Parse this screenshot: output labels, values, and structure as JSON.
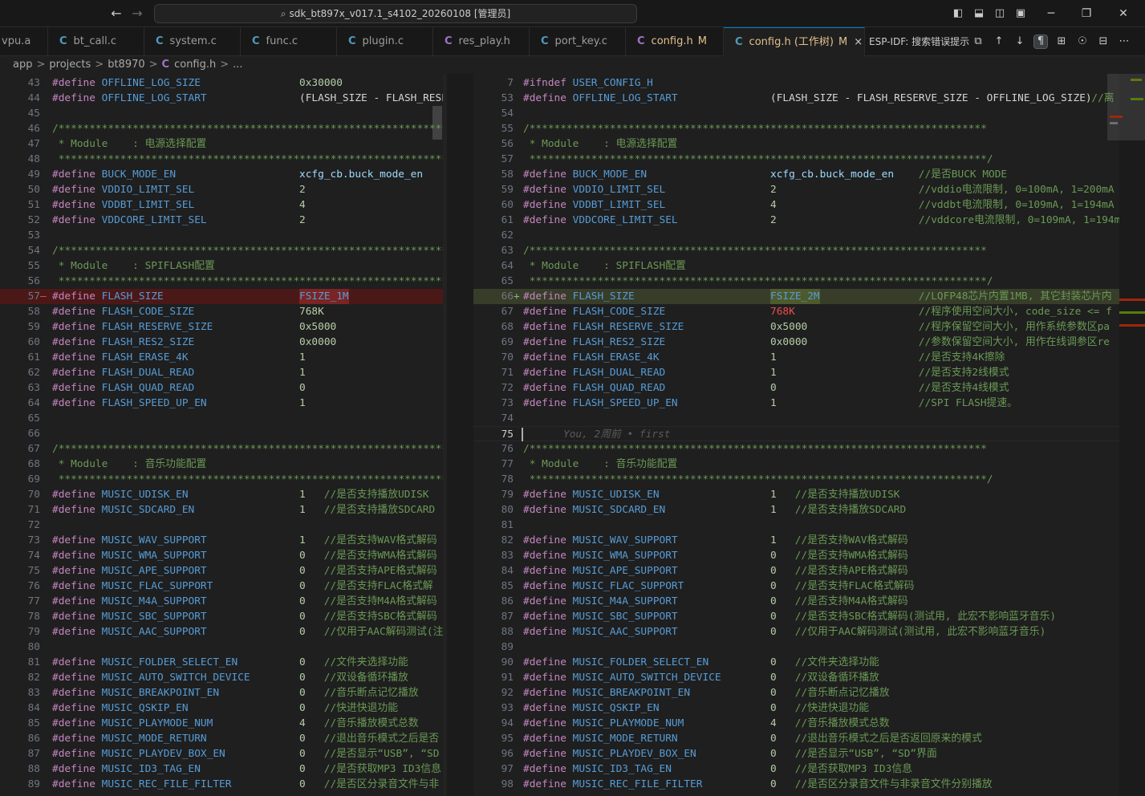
{
  "titlebar": {
    "search_text": "sdk_bt897x_v017.1_s4102_20260108 [管理员]",
    "back_icon": "arrow-left-icon",
    "forward_icon": "arrow-right-icon"
  },
  "tabs": [
    {
      "label": "vpu.a",
      "icon": "",
      "modified": false
    },
    {
      "label": "bt_call.c",
      "icon": "C",
      "modified": false
    },
    {
      "label": "system.c",
      "icon": "C",
      "modified": false
    },
    {
      "label": "func.c",
      "icon": "C",
      "modified": false
    },
    {
      "label": "plugin.c",
      "icon": "C",
      "modified": false
    },
    {
      "label": "res_play.h",
      "icon": "C",
      "modified": false
    },
    {
      "label": "port_key.c",
      "icon": "C",
      "modified": false
    },
    {
      "label": "config.h",
      "icon": "C",
      "modified": true,
      "mark": "M"
    },
    {
      "label": "config.h (工作树)",
      "icon": "C",
      "modified": true,
      "mark": "M",
      "active": true,
      "close": "×"
    }
  ],
  "toolbar": {
    "esp_label": "ESP-IDF: 搜索错误提示"
  },
  "breadcrumb": {
    "items": [
      "app",
      "projects",
      "bt8970",
      "config.h",
      "..."
    ],
    "file_icon": "C",
    "sep": ">"
  },
  "left_editor": {
    "lines": [
      {
        "n": "43",
        "t": "define",
        "name": "OFFLINE_LOG_SIZE",
        "value": "0x30000"
      },
      {
        "n": "44",
        "t": "define",
        "name": "OFFLINE_LOG_START",
        "value": "(FLASH_SIZE - FLASH_RESE"
      },
      {
        "n": "45",
        "t": "blank"
      },
      {
        "n": "46",
        "t": "star",
        "text": "/**************************************************************************************"
      },
      {
        "n": "47",
        "t": "module",
        "text": " * Module    : 电源选择配置"
      },
      {
        "n": "48",
        "t": "star",
        "text": " **************************************************************************************"
      },
      {
        "n": "49",
        "t": "define",
        "name": "BUCK_MODE_EN",
        "value": "xcfg_cb.buck_mode_en"
      },
      {
        "n": "50",
        "t": "define",
        "name": "VDDIO_LIMIT_SEL",
        "value": "2"
      },
      {
        "n": "51",
        "t": "define",
        "name": "VDDBT_LIMIT_SEL",
        "value": "4"
      },
      {
        "n": "52",
        "t": "define",
        "name": "VDDCORE_LIMIT_SEL",
        "value": "2"
      },
      {
        "n": "53",
        "t": "blank"
      },
      {
        "n": "54",
        "t": "star",
        "text": "/**************************************************************************************"
      },
      {
        "n": "55",
        "t": "module",
        "text": " * Module    : SPIFLASH配置"
      },
      {
        "n": "56",
        "t": "star",
        "text": " **************************************************************************************"
      },
      {
        "n": "57",
        "t": "define",
        "name": "FLASH_SIZE",
        "value": "FSIZE_1M",
        "diff": "del",
        "marker": "—"
      },
      {
        "n": "58",
        "t": "define",
        "name": "FLASH_CODE_SIZE",
        "value": "768K"
      },
      {
        "n": "59",
        "t": "define",
        "name": "FLASH_RESERVE_SIZE",
        "value": "0x5000"
      },
      {
        "n": "60",
        "t": "define",
        "name": "FLASH_RES2_SIZE",
        "value": "0x0000"
      },
      {
        "n": "61",
        "t": "define",
        "name": "FLASH_ERASE_4K",
        "value": "1"
      },
      {
        "n": "62",
        "t": "define",
        "name": "FLASH_DUAL_READ",
        "value": "1"
      },
      {
        "n": "63",
        "t": "define",
        "name": "FLASH_QUAD_READ",
        "value": "0"
      },
      {
        "n": "64",
        "t": "define",
        "name": "FLASH_SPEED_UP_EN",
        "value": "1"
      },
      {
        "n": "65",
        "t": "blank"
      },
      {
        "n": "66",
        "t": "blank"
      },
      {
        "n": "67",
        "t": "star",
        "text": "/**************************************************************************************"
      },
      {
        "n": "68",
        "t": "module",
        "text": " * Module    : 音乐功能配置"
      },
      {
        "n": "69",
        "t": "star",
        "text": " **************************************************************************************"
      },
      {
        "n": "70",
        "t": "define",
        "name": "MUSIC_UDISK_EN",
        "value": "1",
        "comment": "//是否支持播放UDISK"
      },
      {
        "n": "71",
        "t": "define",
        "name": "MUSIC_SDCARD_EN",
        "value": "1",
        "comment": "//是否支持播放SDCARD"
      },
      {
        "n": "72",
        "t": "blank"
      },
      {
        "n": "73",
        "t": "define",
        "name": "MUSIC_WAV_SUPPORT",
        "value": "1",
        "comment": "//是否支持WAV格式解码"
      },
      {
        "n": "74",
        "t": "define",
        "name": "MUSIC_WMA_SUPPORT",
        "value": "0",
        "comment": "//是否支持WMA格式解码"
      },
      {
        "n": "75",
        "t": "define",
        "name": "MUSIC_APE_SUPPORT",
        "value": "0",
        "comment": "//是否支持APE格式解码"
      },
      {
        "n": "76",
        "t": "define",
        "name": "MUSIC_FLAC_SUPPORT",
        "value": "0",
        "comment": "//是否支持FLAC格式解"
      },
      {
        "n": "77",
        "t": "define",
        "name": "MUSIC_M4A_SUPPORT",
        "value": "0",
        "comment": "//是否支持M4A格式解码"
      },
      {
        "n": "78",
        "t": "define",
        "name": "MUSIC_SBC_SUPPORT",
        "value": "0",
        "comment": "//是否支持SBC格式解码"
      },
      {
        "n": "79",
        "t": "define",
        "name": "MUSIC_AAC_SUPPORT",
        "value": "0",
        "comment": "//仅用于AAC解码测试(注"
      },
      {
        "n": "80",
        "t": "blank"
      },
      {
        "n": "81",
        "t": "define",
        "name": "MUSIC_FOLDER_SELECT_EN",
        "value": "0",
        "comment": "//文件夹选择功能"
      },
      {
        "n": "82",
        "t": "define",
        "name": "MUSIC_AUTO_SWITCH_DEVICE",
        "value": "0",
        "comment": "//双设备循环播放"
      },
      {
        "n": "83",
        "t": "define",
        "name": "MUSIC_BREAKPOINT_EN",
        "value": "0",
        "comment": "//音乐断点记忆播放"
      },
      {
        "n": "84",
        "t": "define",
        "name": "MUSIC_QSKIP_EN",
        "value": "0",
        "comment": "//快进快退功能"
      },
      {
        "n": "85",
        "t": "define",
        "name": "MUSIC_PLAYMODE_NUM",
        "value": "4",
        "comment": "//音乐播放模式总数"
      },
      {
        "n": "86",
        "t": "define",
        "name": "MUSIC_MODE_RETURN",
        "value": "0",
        "comment": "//退出音乐模式之后是否"
      },
      {
        "n": "87",
        "t": "define",
        "name": "MUSIC_PLAYDEV_BOX_EN",
        "value": "0",
        "comment": "//是否显示“USB”, “SD"
      },
      {
        "n": "88",
        "t": "define",
        "name": "MUSIC_ID3_TAG_EN",
        "value": "0",
        "comment": "//是否获取MP3 ID3信息"
      },
      {
        "n": "89",
        "t": "define",
        "name": "MUSIC_REC_FILE_FILTER",
        "value": "0",
        "comment": "//是否区分录音文件与非"
      }
    ]
  },
  "right_editor": {
    "lines": [
      {
        "n": "7",
        "t": "ifndef",
        "text": "USER_CONFIG_H"
      },
      {
        "n": "53",
        "t": "define",
        "name": "OFFLINE_LOG_START",
        "value": "(FLASH_SIZE - FLASH_RESERVE_SIZE - OFFLINE_LOG_SIZE)",
        "comment": "//离"
      },
      {
        "n": "54",
        "t": "blank"
      },
      {
        "n": "55",
        "t": "star",
        "text": "/**************************************************************************"
      },
      {
        "n": "56",
        "t": "module",
        "text": " * Module    : 电源选择配置"
      },
      {
        "n": "57",
        "t": "star",
        "text": " **************************************************************************/"
      },
      {
        "n": "58",
        "t": "define",
        "name": "BUCK_MODE_EN",
        "value": "xcfg_cb.buck_mode_en",
        "comment": "//是否BUCK MODE"
      },
      {
        "n": "59",
        "t": "define",
        "name": "VDDIO_LIMIT_SEL",
        "value": "2",
        "comment": "//vddio电流限制, 0=100mA, 1=200mA"
      },
      {
        "n": "60",
        "t": "define",
        "name": "VDDBT_LIMIT_SEL",
        "value": "4",
        "comment": "//vddbt电流限制, 0=109mA, 1=194mA"
      },
      {
        "n": "61",
        "t": "define",
        "name": "VDDCORE_LIMIT_SEL",
        "value": "2",
        "comment": "//vddcore电流限制, 0=109mA, 1=194m"
      },
      {
        "n": "62",
        "t": "blank"
      },
      {
        "n": "63",
        "t": "star",
        "text": "/**************************************************************************"
      },
      {
        "n": "64",
        "t": "module",
        "text": " * Module    : SPIFLASH配置"
      },
      {
        "n": "65",
        "t": "star",
        "text": " **************************************************************************/"
      },
      {
        "n": "66",
        "t": "define",
        "name": "FLASH_SIZE",
        "value": "FSIZE_2M",
        "comment": "//LQFP48芯片内置1MB, 其它封装芯片内",
        "diff": "ins",
        "marker": "+"
      },
      {
        "n": "67",
        "t": "define",
        "name": "FLASH_CODE_SIZE",
        "value": "768K",
        "comment": "//程序使用空间大小, code_size <= f",
        "valueRed": true
      },
      {
        "n": "68",
        "t": "define",
        "name": "FLASH_RESERVE_SIZE",
        "value": "0x5000",
        "comment": "//程序保留空间大小, 用作系统参数区pa"
      },
      {
        "n": "69",
        "t": "define",
        "name": "FLASH_RES2_SIZE",
        "value": "0x0000",
        "comment": "//参数保留空间大小, 用作在线调参区re"
      },
      {
        "n": "70",
        "t": "define",
        "name": "FLASH_ERASE_4K",
        "value": "1",
        "comment": "//是否支持4K擦除"
      },
      {
        "n": "71",
        "t": "define",
        "name": "FLASH_DUAL_READ",
        "value": "1",
        "comment": "//是否支持2线模式"
      },
      {
        "n": "72",
        "t": "define",
        "name": "FLASH_QUAD_READ",
        "value": "0",
        "comment": "//是否支持4线模式"
      },
      {
        "n": "73",
        "t": "define",
        "name": "FLASH_SPEED_UP_EN",
        "value": "1",
        "comment": "//SPI FLASH提速。"
      },
      {
        "n": "74",
        "t": "blank"
      },
      {
        "n": "75",
        "t": "blame",
        "text": "You, 2周前 • first",
        "current": true
      },
      {
        "n": "76",
        "t": "star",
        "text": "/**************************************************************************"
      },
      {
        "n": "77",
        "t": "module",
        "text": " * Module    : 音乐功能配置"
      },
      {
        "n": "78",
        "t": "star",
        "text": " **************************************************************************/"
      },
      {
        "n": "79",
        "t": "define",
        "name": "MUSIC_UDISK_EN",
        "value": "1",
        "comment": "//是否支持播放UDISK"
      },
      {
        "n": "80",
        "t": "define",
        "name": "MUSIC_SDCARD_EN",
        "value": "1",
        "comment": "//是否支持播放SDCARD"
      },
      {
        "n": "81",
        "t": "blank"
      },
      {
        "n": "82",
        "t": "define",
        "name": "MUSIC_WAV_SUPPORT",
        "value": "1",
        "comment": "//是否支持WAV格式解码"
      },
      {
        "n": "83",
        "t": "define",
        "name": "MUSIC_WMA_SUPPORT",
        "value": "0",
        "comment": "//是否支持WMA格式解码"
      },
      {
        "n": "84",
        "t": "define",
        "name": "MUSIC_APE_SUPPORT",
        "value": "0",
        "comment": "//是否支持APE格式解码"
      },
      {
        "n": "85",
        "t": "define",
        "name": "MUSIC_FLAC_SUPPORT",
        "value": "0",
        "comment": "//是否支持FLAC格式解码"
      },
      {
        "n": "86",
        "t": "define",
        "name": "MUSIC_M4A_SUPPORT",
        "value": "0",
        "comment": "//是否支持M4A格式解码"
      },
      {
        "n": "87",
        "t": "define",
        "name": "MUSIC_SBC_SUPPORT",
        "value": "0",
        "comment": "//是否支持SBC格式解码(测试用, 此宏不影响蓝牙音乐)"
      },
      {
        "n": "88",
        "t": "define",
        "name": "MUSIC_AAC_SUPPORT",
        "value": "0",
        "comment": "//仅用于AAC解码测试(测试用, 此宏不影响蓝牙音乐)"
      },
      {
        "n": "89",
        "t": "blank"
      },
      {
        "n": "90",
        "t": "define",
        "name": "MUSIC_FOLDER_SELECT_EN",
        "value": "0",
        "comment": "//文件夹选择功能"
      },
      {
        "n": "91",
        "t": "define",
        "name": "MUSIC_AUTO_SWITCH_DEVICE",
        "value": "0",
        "comment": "//双设备循环播放"
      },
      {
        "n": "92",
        "t": "define",
        "name": "MUSIC_BREAKPOINT_EN",
        "value": "0",
        "comment": "//音乐断点记忆播放"
      },
      {
        "n": "93",
        "t": "define",
        "name": "MUSIC_QSKIP_EN",
        "value": "0",
        "comment": "//快进快退功能"
      },
      {
        "n": "94",
        "t": "define",
        "name": "MUSIC_PLAYMODE_NUM",
        "value": "4",
        "comment": "//音乐播放模式总数"
      },
      {
        "n": "95",
        "t": "define",
        "name": "MUSIC_MODE_RETURN",
        "value": "0",
        "comment": "//退出音乐模式之后是否返回原来的模式"
      },
      {
        "n": "96",
        "t": "define",
        "name": "MUSIC_PLAYDEV_BOX_EN",
        "value": "0",
        "comment": "//是否显示“USB”, “SD”界面"
      },
      {
        "n": "97",
        "t": "define",
        "name": "MUSIC_ID3_TAG_EN",
        "value": "0",
        "comment": "//是否获取MP3 ID3信息"
      },
      {
        "n": "98",
        "t": "define",
        "name": "MUSIC_REC_FILE_FILTER",
        "value": "0",
        "comment": "//是否区分录音文件与非录音文件分别播放"
      }
    ]
  },
  "colors": {
    "background": "#1f1f1f",
    "deleted_line": "#4b1818",
    "inserted_line": "#373d29",
    "macro": "#569cd6",
    "keyword": "#c586c0",
    "comment": "#6a9955"
  }
}
